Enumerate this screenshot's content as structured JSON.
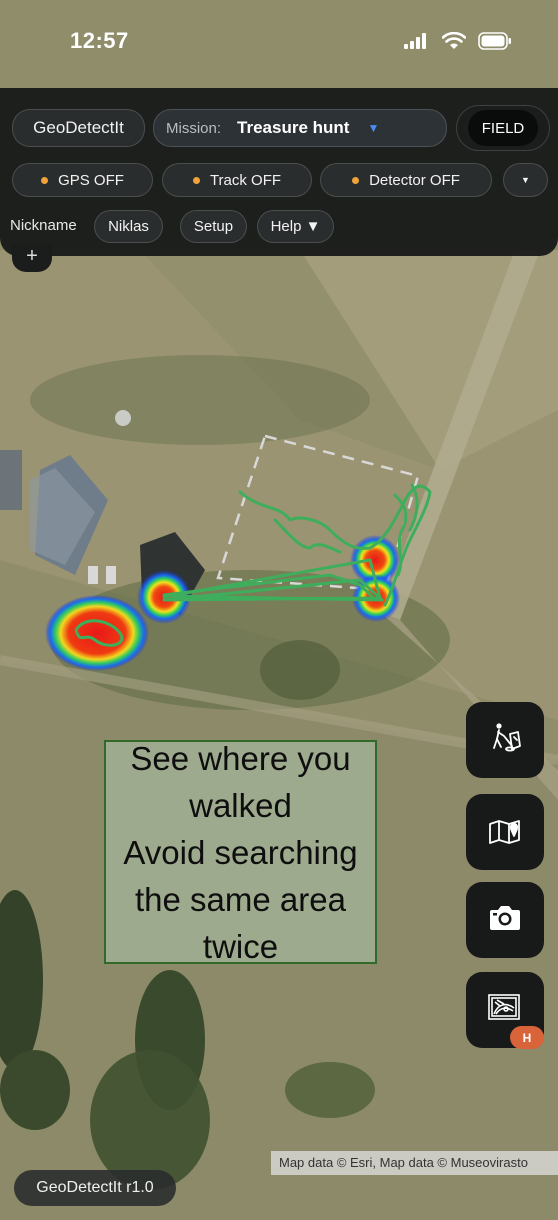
{
  "status_bar": {
    "time": "12:57",
    "icons": [
      "cellular-signal-icon",
      "wifi-icon",
      "battery-icon"
    ]
  },
  "top_panel": {
    "app_button": "GeoDetectIt",
    "mission": {
      "label": "Mission:",
      "value": "Treasure hunt",
      "caret": "▼"
    },
    "mode_button": "FIELD",
    "toggles": [
      {
        "label": "GPS OFF",
        "status_color": "#f2a43a"
      },
      {
        "label": "Track OFF",
        "status_color": "#f2a43a"
      },
      {
        "label": "Detector OFF",
        "status_color": "#f2a43a"
      }
    ],
    "more_caret": "▼",
    "nickname_label": "Nickname",
    "nickname_value": "Niklas",
    "setup_button": "Setup",
    "help_button": "Help ▼"
  },
  "map": {
    "zoom_in_label": "+",
    "note": [
      "See where you",
      "walked",
      "Avoid searching",
      "the same area",
      "twice"
    ],
    "attribution": "Map data © Esri, Map data © Museovirasto",
    "track_color": "#3fae5c",
    "survey_area_color": "#d8d8d8"
  },
  "side_buttons": {
    "icons": [
      "detectorist-icon",
      "map-icon",
      "camera-icon",
      "heatmap-icon"
    ],
    "heatmap_badge": "H"
  },
  "footer": {
    "version": "GeoDetectIt r1.0"
  },
  "colors": {
    "panel": "#161818",
    "accent": "#4a8cf0",
    "status_off": "#f2a43a",
    "badge": "#d9643a"
  }
}
